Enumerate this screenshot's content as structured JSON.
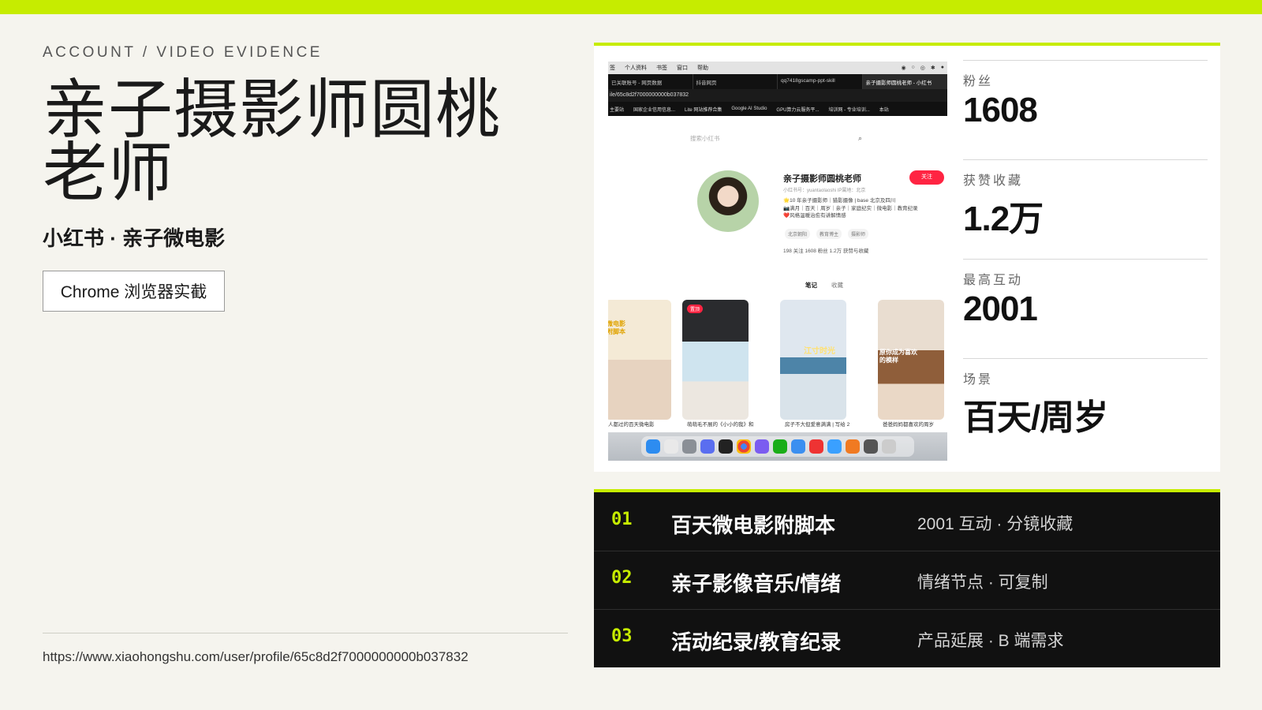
{
  "eyebrow": "ACCOUNT / VIDEO EVIDENCE",
  "title": "亲子摄影师圆桃老师",
  "subtitle": "小红书 · 亲子微电影",
  "source_badge": "Chrome 浏览器实截",
  "url": "https://www.xiaohongshu.com/user/profile/65c8d2f7000000000b037832",
  "screenshot": {
    "menu": [
      "签",
      "个人资料",
      "书签",
      "窗口",
      "帮助"
    ],
    "tabs": [
      "已关联账号 - 网页数据",
      "抖音网页",
      "qq7418gscamp-ppt-skill",
      "亲子摄影师圆桃老师 - 小红书"
    ],
    "address": "ile/65c8d2f7000000000b037832",
    "bookmarks": [
      "主要站",
      "国家企业信用信息...",
      "Lite 网站推荐合集",
      "Google AI Studio",
      "GPU算力云服务平...",
      "培训网 - 专业培训...",
      "本站"
    ],
    "search_placeholder": "搜索小红书",
    "profile_name": "亲子摄影师圆桃老师",
    "follow_button": "关注",
    "profile_id": "小红书号：yuantaolaoshi  IP属地：北京",
    "bio_lines": [
      "🌟10 年亲子摄影师｜猎影摄像 | base 北京及四川",
      "📷满月｜百天｜周岁｜亲子｜家庭纪实｜微电影｜教育纪录",
      "❤️风格温暖治愈有讲解情感"
    ],
    "tags": [
      "北京朝阳",
      "教育博主",
      "摄影师"
    ],
    "stats_line": "198 关注  1608 粉丝  1.2万 获赞与收藏",
    "tab_notes": "笔记",
    "tab_collect": "收藏",
    "card_captions": [
      "人都过的百天微电影",
      "萌萌毛不展的《小小的我》和",
      "房子不大但爱意满满 | 写给 2",
      "爸爸妈妈都喜欢的周岁"
    ],
    "card_badge": "置顶",
    "card_overlay_1": "微电影附脚本",
    "card_overlay_3": "江寸时光",
    "card_overlay_4": "原你成为喜欢的模样"
  },
  "stats": [
    {
      "label": "粉丝",
      "value": "1608"
    },
    {
      "label": "获赞收藏",
      "value": "1.2万"
    },
    {
      "label": "最高互动",
      "value": "2001"
    },
    {
      "label": "场景",
      "value": "百天/周岁"
    }
  ],
  "rows": [
    {
      "num": "01",
      "title": "百天微电影附脚本",
      "note": "2001 互动 · 分镜收藏"
    },
    {
      "num": "02",
      "title": "亲子影像音乐/情绪",
      "note": "情绪节点 · 可复制"
    },
    {
      "num": "03",
      "title": "活动纪录/教育纪录",
      "note": "产品延展 · B 端需求"
    }
  ],
  "colors": {
    "accent": "#c6ec00",
    "background": "#f5f4ee",
    "table_bg": "#111111",
    "follow_red": "#ff2442"
  }
}
